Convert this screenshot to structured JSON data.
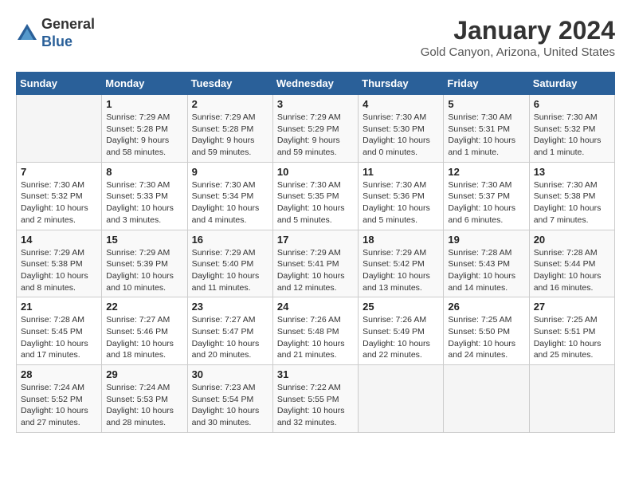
{
  "header": {
    "logo": {
      "general": "General",
      "blue": "Blue"
    },
    "title": "January 2024",
    "subtitle": "Gold Canyon, Arizona, United States"
  },
  "calendar": {
    "days_of_week": [
      "Sunday",
      "Monday",
      "Tuesday",
      "Wednesday",
      "Thursday",
      "Friday",
      "Saturday"
    ],
    "weeks": [
      [
        {
          "day": "",
          "info": ""
        },
        {
          "day": "1",
          "info": "Sunrise: 7:29 AM\nSunset: 5:28 PM\nDaylight: 9 hours\nand 58 minutes."
        },
        {
          "day": "2",
          "info": "Sunrise: 7:29 AM\nSunset: 5:28 PM\nDaylight: 9 hours\nand 59 minutes."
        },
        {
          "day": "3",
          "info": "Sunrise: 7:29 AM\nSunset: 5:29 PM\nDaylight: 9 hours\nand 59 minutes."
        },
        {
          "day": "4",
          "info": "Sunrise: 7:30 AM\nSunset: 5:30 PM\nDaylight: 10 hours\nand 0 minutes."
        },
        {
          "day": "5",
          "info": "Sunrise: 7:30 AM\nSunset: 5:31 PM\nDaylight: 10 hours\nand 1 minute."
        },
        {
          "day": "6",
          "info": "Sunrise: 7:30 AM\nSunset: 5:32 PM\nDaylight: 10 hours\nand 1 minute."
        }
      ],
      [
        {
          "day": "7",
          "info": "Sunrise: 7:30 AM\nSunset: 5:32 PM\nDaylight: 10 hours\nand 2 minutes."
        },
        {
          "day": "8",
          "info": "Sunrise: 7:30 AM\nSunset: 5:33 PM\nDaylight: 10 hours\nand 3 minutes."
        },
        {
          "day": "9",
          "info": "Sunrise: 7:30 AM\nSunset: 5:34 PM\nDaylight: 10 hours\nand 4 minutes."
        },
        {
          "day": "10",
          "info": "Sunrise: 7:30 AM\nSunset: 5:35 PM\nDaylight: 10 hours\nand 5 minutes."
        },
        {
          "day": "11",
          "info": "Sunrise: 7:30 AM\nSunset: 5:36 PM\nDaylight: 10 hours\nand 5 minutes."
        },
        {
          "day": "12",
          "info": "Sunrise: 7:30 AM\nSunset: 5:37 PM\nDaylight: 10 hours\nand 6 minutes."
        },
        {
          "day": "13",
          "info": "Sunrise: 7:30 AM\nSunset: 5:38 PM\nDaylight: 10 hours\nand 7 minutes."
        }
      ],
      [
        {
          "day": "14",
          "info": "Sunrise: 7:29 AM\nSunset: 5:38 PM\nDaylight: 10 hours\nand 8 minutes."
        },
        {
          "day": "15",
          "info": "Sunrise: 7:29 AM\nSunset: 5:39 PM\nDaylight: 10 hours\nand 10 minutes."
        },
        {
          "day": "16",
          "info": "Sunrise: 7:29 AM\nSunset: 5:40 PM\nDaylight: 10 hours\nand 11 minutes."
        },
        {
          "day": "17",
          "info": "Sunrise: 7:29 AM\nSunset: 5:41 PM\nDaylight: 10 hours\nand 12 minutes."
        },
        {
          "day": "18",
          "info": "Sunrise: 7:29 AM\nSunset: 5:42 PM\nDaylight: 10 hours\nand 13 minutes."
        },
        {
          "day": "19",
          "info": "Sunrise: 7:28 AM\nSunset: 5:43 PM\nDaylight: 10 hours\nand 14 minutes."
        },
        {
          "day": "20",
          "info": "Sunrise: 7:28 AM\nSunset: 5:44 PM\nDaylight: 10 hours\nand 16 minutes."
        }
      ],
      [
        {
          "day": "21",
          "info": "Sunrise: 7:28 AM\nSunset: 5:45 PM\nDaylight: 10 hours\nand 17 minutes."
        },
        {
          "day": "22",
          "info": "Sunrise: 7:27 AM\nSunset: 5:46 PM\nDaylight: 10 hours\nand 18 minutes."
        },
        {
          "day": "23",
          "info": "Sunrise: 7:27 AM\nSunset: 5:47 PM\nDaylight: 10 hours\nand 20 minutes."
        },
        {
          "day": "24",
          "info": "Sunrise: 7:26 AM\nSunset: 5:48 PM\nDaylight: 10 hours\nand 21 minutes."
        },
        {
          "day": "25",
          "info": "Sunrise: 7:26 AM\nSunset: 5:49 PM\nDaylight: 10 hours\nand 22 minutes."
        },
        {
          "day": "26",
          "info": "Sunrise: 7:25 AM\nSunset: 5:50 PM\nDaylight: 10 hours\nand 24 minutes."
        },
        {
          "day": "27",
          "info": "Sunrise: 7:25 AM\nSunset: 5:51 PM\nDaylight: 10 hours\nand 25 minutes."
        }
      ],
      [
        {
          "day": "28",
          "info": "Sunrise: 7:24 AM\nSunset: 5:52 PM\nDaylight: 10 hours\nand 27 minutes."
        },
        {
          "day": "29",
          "info": "Sunrise: 7:24 AM\nSunset: 5:53 PM\nDaylight: 10 hours\nand 28 minutes."
        },
        {
          "day": "30",
          "info": "Sunrise: 7:23 AM\nSunset: 5:54 PM\nDaylight: 10 hours\nand 30 minutes."
        },
        {
          "day": "31",
          "info": "Sunrise: 7:22 AM\nSunset: 5:55 PM\nDaylight: 10 hours\nand 32 minutes."
        },
        {
          "day": "",
          "info": ""
        },
        {
          "day": "",
          "info": ""
        },
        {
          "day": "",
          "info": ""
        }
      ]
    ]
  }
}
